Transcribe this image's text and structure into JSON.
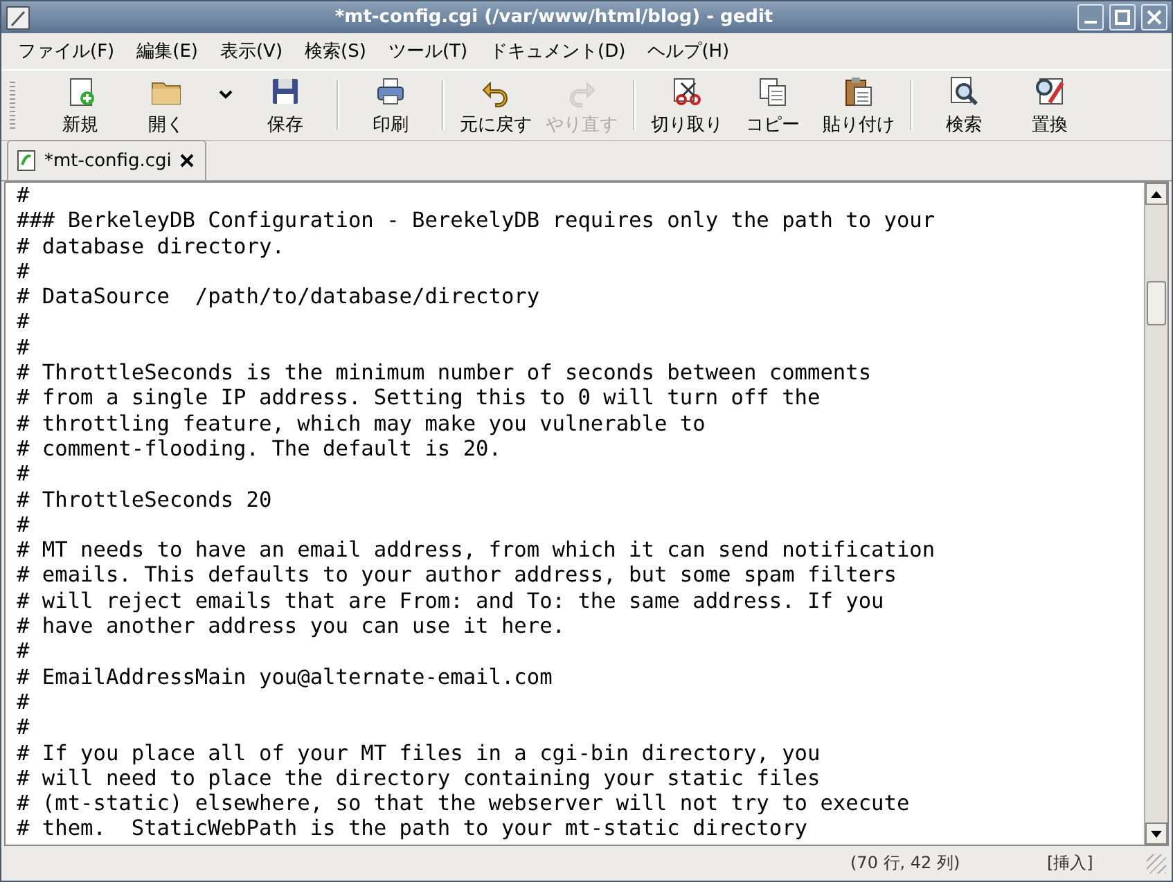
{
  "window": {
    "title": "*mt-config.cgi (/var/www/html/blog) - gedit"
  },
  "menu": [
    "ファイル(F)",
    "編集(E)",
    "表示(V)",
    "検索(S)",
    "ツール(T)",
    "ドキュメント(D)",
    "ヘルプ(H)"
  ],
  "toolbar": [
    {
      "kind": "button",
      "label": "新規",
      "disabled": false
    },
    {
      "kind": "button",
      "label": "開く",
      "disabled": false
    },
    {
      "kind": "dropdown"
    },
    {
      "kind": "button",
      "label": "保存",
      "disabled": false
    },
    {
      "kind": "separator"
    },
    {
      "kind": "button",
      "label": "印刷",
      "disabled": false
    },
    {
      "kind": "separator"
    },
    {
      "kind": "button",
      "label": "元に戻す",
      "disabled": false
    },
    {
      "kind": "button",
      "label": "やり直す",
      "disabled": true
    },
    {
      "kind": "separator"
    },
    {
      "kind": "button",
      "label": "切り取り",
      "disabled": false
    },
    {
      "kind": "button",
      "label": "コピー",
      "disabled": false
    },
    {
      "kind": "button",
      "label": "貼り付け",
      "disabled": false
    },
    {
      "kind": "separator"
    },
    {
      "kind": "button",
      "label": "検索",
      "disabled": false
    },
    {
      "kind": "button",
      "label": "置換",
      "disabled": false
    }
  ],
  "tabs": [
    {
      "label": "*mt-config.cgi",
      "selected": true
    }
  ],
  "editor": {
    "lines": [
      "#",
      "### BerkeleyDB Configuration - BerekelyDB requires only the path to your",
      "# database directory.",
      "#",
      "# DataSource  /path/to/database/directory",
      "#",
      "#",
      "# ThrottleSeconds is the minimum number of seconds between comments",
      "# from a single IP address. Setting this to 0 will turn off the",
      "# throttling feature, which may make you vulnerable to",
      "# comment-flooding. The default is 20.",
      "#",
      "# ThrottleSeconds 20",
      "#",
      "# MT needs to have an email address, from which it can send notification",
      "# emails. This defaults to your author address, but some spam filters",
      "# will reject emails that are From: and To: the same address. If you",
      "# have another address you can use it here.",
      "#",
      "# EmailAddressMain you@alternate-email.com",
      "#",
      "#",
      "# If you place all of your MT files in a cgi-bin directory, you",
      "# will need to place the directory containing your static files",
      "# (mt-static) elsewhere, so that the webserver will not try to execute",
      "# them.  StaticWebPath is the path to your mt-static directory"
    ]
  },
  "status_bar": {
    "position": "(70 行, 42 列)",
    "mode": "[挿入]"
  }
}
